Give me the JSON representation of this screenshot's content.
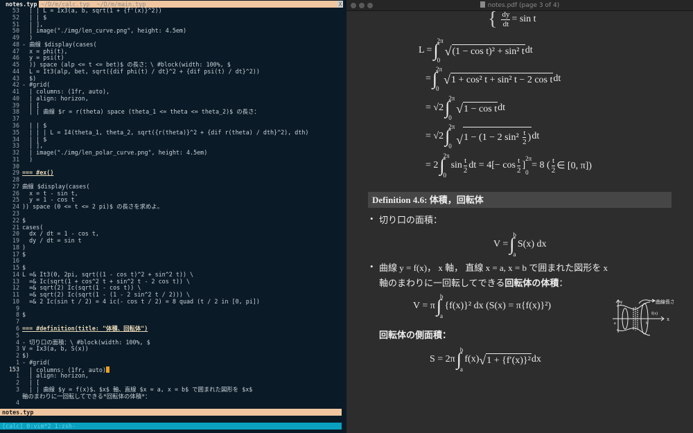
{
  "terminal": {
    "active_tab": "notes.typ",
    "other_tabs": "~/D/m/calc.typ  ~/D/m/main.typ",
    "close": "X",
    "lines": [
      {
        "n": "53",
        "t": "  | | L = Ix3(a, b, sqrt(1 + {f'(x)}^2))"
      },
      {
        "n": "52",
        "t": "  | | $"
      },
      {
        "n": "51",
        "t": "  | ],"
      },
      {
        "n": "50",
        "t": "  | image(\"./img/len_curve.png\", height: 4.5em)"
      },
      {
        "n": "49",
        "t": "  )"
      },
      {
        "n": "48",
        "t": "- 曲線 $display(cases("
      },
      {
        "n": "47",
        "t": "  x = phi(t),"
      },
      {
        "n": "46",
        "t": "  y = psi(t)"
      },
      {
        "n": "45",
        "t": "  )) space (alp <= t <= bet)$ の長さ：\\ #block(width: 100%, $"
      },
      {
        "n": "44",
        "t": "  L = It3(alp, bet, sqrt({dif phi(t) / dt}^2 + {dif psi(t) / dt}^2))"
      },
      {
        "n": "43",
        "t": "  $)"
      },
      {
        "n": "42",
        "t": "- #grid("
      },
      {
        "n": "41",
        "t": "  | columns: (1fr, auto),"
      },
      {
        "n": "40",
        "t": "  | align: horizon,"
      },
      {
        "n": "39",
        "t": "  | ["
      },
      {
        "n": "38",
        "t": "  | | 曲線 $r = r(theta) space (theta_1 <= theta <= theta_2)$ の長さ："
      },
      {
        "n": "37",
        "t": ""
      },
      {
        "n": "36",
        "t": "  | | $"
      },
      {
        "n": "35",
        "t": "  | | | L = I4(theta_1, theta_2, sqrt({r(theta)}^2 + {dif r(theta) / dth}^2), dth)"
      },
      {
        "n": "34",
        "t": "  | | $"
      },
      {
        "n": "33",
        "t": "  | ],"
      },
      {
        "n": "32",
        "t": "  | image(\"./img/len_polar_curve.png\", height: 4.5em)"
      },
      {
        "n": "31",
        "t": "  )"
      },
      {
        "n": "30",
        "t": ""
      },
      {
        "n": "29",
        "t": "=== #ex()",
        "head": true
      },
      {
        "n": "28",
        "t": ""
      },
      {
        "n": "27",
        "t": "曲線 $display(cases("
      },
      {
        "n": "26",
        "t": "  x = t - sin t,"
      },
      {
        "n": "25",
        "t": "  y = 1 - cos t"
      },
      {
        "n": "24",
        "t": ")) space (0 <= t <= 2 pi)$ の長さを求めよ。"
      },
      {
        "n": "23",
        "t": ""
      },
      {
        "n": "22",
        "t": "$"
      },
      {
        "n": "21",
        "t": "cases("
      },
      {
        "n": "20",
        "t": "  dx / dt = 1 - cos t,"
      },
      {
        "n": "19",
        "t": "  dy / dt = sin t"
      },
      {
        "n": "18",
        "t": ")"
      },
      {
        "n": "17",
        "t": "$"
      },
      {
        "n": "16",
        "t": ""
      },
      {
        "n": "15",
        "t": "$"
      },
      {
        "n": "14",
        "t": "L =& It3(0, 2pi, sqrt((1 - cos t)^2 + sin^2 t)) \\"
      },
      {
        "n": "13",
        "t": "  =& Ic(sqrt(1 + cos^2 t + sin^2 t - 2 cos t)) \\"
      },
      {
        "n": "12",
        "t": "  =& sqrt(2) Ic(sqrt(1 - cos t)) \\"
      },
      {
        "n": "11",
        "t": "  =& sqrt(2) Ic(sqrt(1 - (1 - 2 sin^2 t / 2))) \\"
      },
      {
        "n": "10",
        "t": "  =& 2 Ic(sin t / 2) = 4 ic(- cos t / 2) = 8 quad (t / 2 in [0, pi])"
      },
      {
        "n": "9",
        "t": ""
      },
      {
        "n": "8",
        "t": "$"
      },
      {
        "n": "7",
        "t": ""
      },
      {
        "n": "6",
        "t": "=== #definition(title: \"体積、回転体\")",
        "head": true
      },
      {
        "n": "5",
        "t": ""
      },
      {
        "n": "4",
        "t": "- 切り口の面積：\\ #block(width: 100%, $"
      },
      {
        "n": "3",
        "t": "V = Ix3(a, b, S(x))"
      },
      {
        "n": "2",
        "t": "$)"
      },
      {
        "n": "1",
        "t": "- #grid("
      },
      {
        "n": "153",
        "t": "  | columns: (1fr, auto)",
        "cur": true
      },
      {
        "n": "1",
        "t": "  | align: horizon,"
      },
      {
        "n": "2",
        "t": "  | ["
      },
      {
        "n": "3",
        "t": "  | | 曲線 $y = f(x)$、$x$ 軸、直線 $x = a, x = b$ で囲まれた図形を $x$"
      },
      {
        "n": "",
        "t": "軸のまわりに一回転してできる*回転体の体積*："
      },
      {
        "n": "4",
        "t": ""
      }
    ],
    "statusline": "notes.typ",
    "tmux_bar": "[calc] 0:vim*2 1:zsh-"
  },
  "pdf": {
    "window_title": "notes.pdf (page 3 of 4)",
    "top_fragment": {
      "num": "dy",
      "den": "dt",
      "rest": " = sin t"
    },
    "derivation": [
      [
        {
          "t": "L = "
        },
        {
          "int": [
            "0",
            "2π"
          ]
        },
        {
          "sqrt": [
            {
              "t": "(1 − cos t)² + sin² t"
            }
          ]
        },
        {
          "t": " dt"
        }
      ],
      [
        {
          "t": "= "
        },
        {
          "int": [
            "0",
            "2π"
          ]
        },
        {
          "sqrt": [
            {
              "t": "1 + cos² t + sin² t − 2 cos t"
            }
          ]
        },
        {
          "t": " dt"
        }
      ],
      [
        {
          "t": "= √2 "
        },
        {
          "int": [
            "0",
            "2π"
          ]
        },
        {
          "sqrt": [
            {
              "t": "1 − cos t"
            }
          ]
        },
        {
          "t": " dt"
        }
      ],
      [
        {
          "t": "= √2 "
        },
        {
          "int": [
            "0",
            "2π"
          ]
        },
        {
          "sqrt": [
            {
              "t": "1 − (1 − 2 sin² "
            },
            {
              "frac": [
                "t",
                "2"
              ]
            },
            {
              "t": ")"
            }
          ]
        },
        {
          "t": " dt"
        }
      ],
      [
        {
          "t": "= 2 "
        },
        {
          "int": [
            "0",
            "2π"
          ]
        },
        {
          "t": "sin "
        },
        {
          "frac": [
            "t",
            "2"
          ]
        },
        {
          "t": " dt = 4[− cos "
        },
        {
          "frac": [
            "t",
            "2"
          ]
        },
        {
          "t": "]"
        },
        {
          "lim": [
            "0",
            "2π"
          ]
        },
        {
          "t": " = 8    ("
        },
        {
          "frac": [
            "t",
            "2"
          ]
        },
        {
          "t": " ∈ [0, π])"
        }
      ]
    ],
    "definition_title": "Definition 4.6: 体積，回転体",
    "bullet1": "切り口の面積：",
    "formula_V": [
      {
        "t": "V = "
      },
      {
        "int": [
          "a",
          "b"
        ]
      },
      {
        "t": "S(x) dx"
      }
    ],
    "bullet2_line1": "曲線 y = f(x)， x 軸， 直線 x = a, x = b で囲まれた図形を x",
    "bullet2_line2_plain": "軸のまわりに一回転してできる",
    "bullet2_line2_bold": "回転体の体積",
    "bullet2_line2_end": "：",
    "formula_V2": [
      {
        "t": "V = π "
      },
      {
        "int": [
          "a",
          "b"
        ]
      },
      {
        "t": "{f(x)}² dx    (S(x) = π{f(x)}²)"
      }
    ],
    "lateral_heading": "回転体の側面積：",
    "formula_S": [
      {
        "t": "S = 2π "
      },
      {
        "int": [
          "a",
          "b"
        ]
      },
      {
        "t": "f(x)"
      },
      {
        "sqrt": [
          {
            "t": "1 + {f′(x)}²"
          }
        ]
      },
      {
        "t": " dx"
      }
    ],
    "figure": {
      "arc_label": "曲線長さ",
      "f_label": "f(x)",
      "x_label": "x",
      "y_label": "y",
      "a_label": "a",
      "b_label": "b"
    }
  }
}
